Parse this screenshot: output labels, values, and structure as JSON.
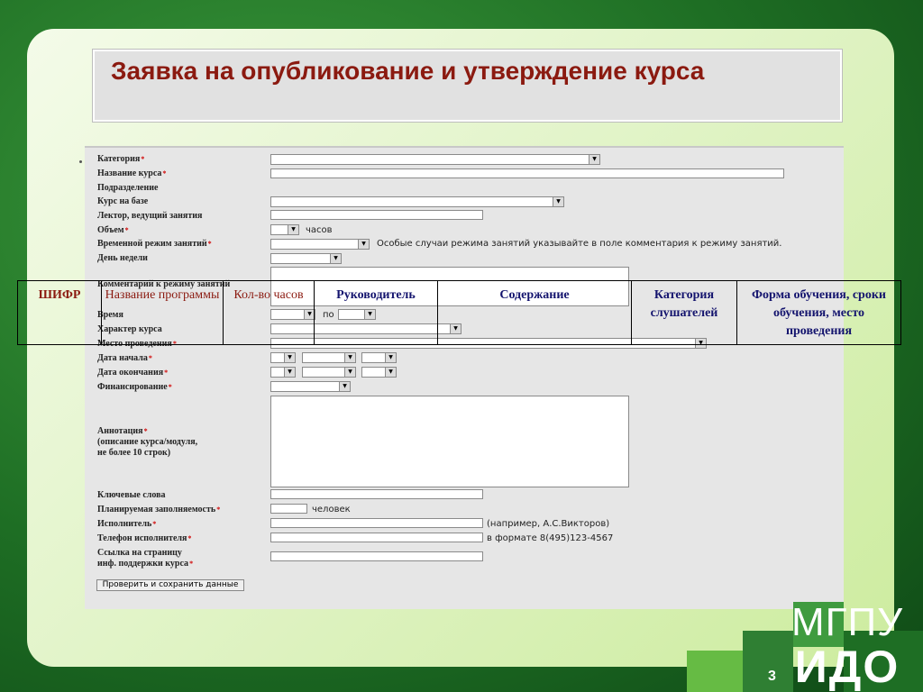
{
  "slide": {
    "title": "Заявка на опубликование и утверждение курса",
    "page_number": "3",
    "logo_line1": "МГПУ",
    "logo_line2": "ИДО"
  },
  "form": {
    "labels": {
      "category": "Категория",
      "course_name": "Название курса",
      "department": "Подразделение",
      "base_course": "Курс на базе",
      "lecturer": "Лектор, ведущий занятия",
      "volume": "Объем",
      "time_mode": "Временной режим занятий",
      "weekday": "День недели",
      "comment_mode": "Комментарий к режиму занятий",
      "time_partial": "Время",
      "course_type": "Характер курса",
      "location": "Место проведения",
      "start_date": "Дата начала",
      "end_date": "Дата окончания",
      "funding": "Финансирование",
      "annotation_1": "Аннотация",
      "annotation_2": "(описание курса/модуля,",
      "annotation_3": "не более 10 строк)",
      "keywords": "Ключевые слова",
      "planned_fill": "Планируемая заполняемость",
      "executor": "Исполнитель",
      "executor_phone": "Телефон исполнителя",
      "link_1": "Ссылка на страницу",
      "link_2": "инф. поддержки курса"
    },
    "notes": {
      "hours": "часов",
      "time_mode_hint": "Особые случаи режима занятий указывайте в поле комментария к режиму занятий.",
      "to": "по",
      "people": "человек",
      "executor_example": "(например, А.С.Викторов)",
      "phone_format": "в формате 8(495)123-4567"
    },
    "submit_label": "Проверить и сохранить данные"
  },
  "overlay_table": {
    "headers": [
      "ШИФР",
      "Название программы",
      "Кол-во часов",
      "Руководитель",
      "Содержание",
      "Категория слушателей",
      "Форма обучения, сроки обучения, место проведения"
    ]
  },
  "colors": {
    "title": "#8b1a10",
    "header_blue": "#14146e",
    "required_mark": "#d00000",
    "background_green": "#1e6e24"
  }
}
